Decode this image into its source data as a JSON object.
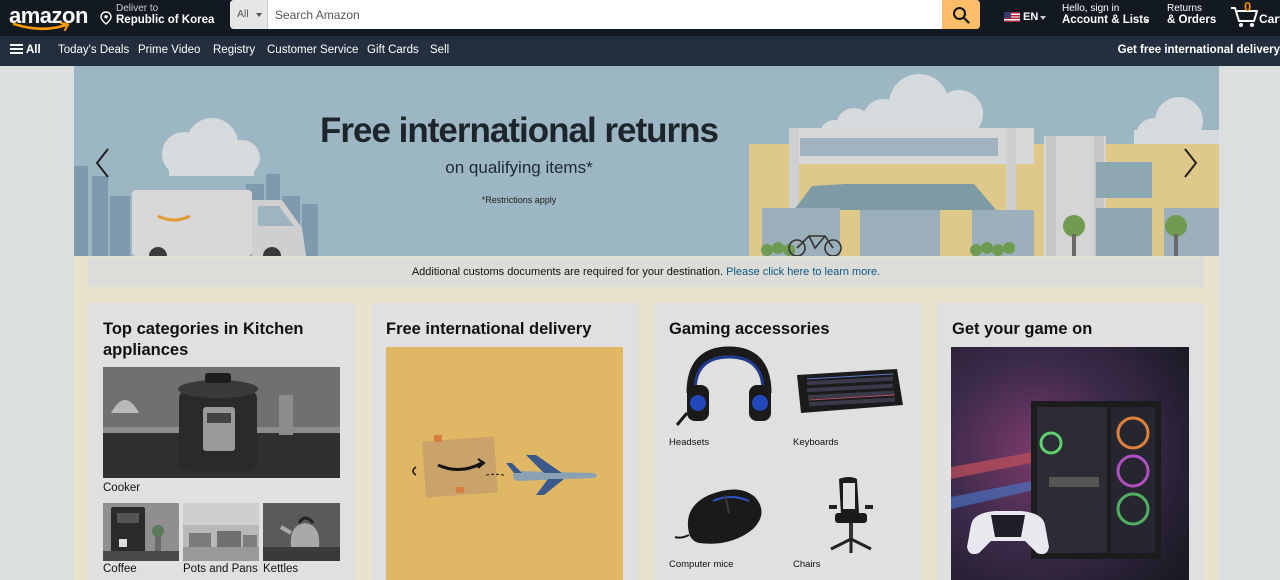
{
  "header": {
    "logo_text": "amazon",
    "deliver_line1": "Deliver to",
    "deliver_line2": "Republic of Korea",
    "search_category": "All",
    "search_placeholder": "Search Amazon",
    "language": "EN",
    "account_line1": "Hello, sign in",
    "account_line2": "Account & Lists",
    "orders_line1": "Returns",
    "orders_line2": "& Orders",
    "cart_count": "0",
    "cart_label": "Cart"
  },
  "subnav": {
    "all_label": "All",
    "items": [
      "Today's Deals",
      "Prime Video",
      "Registry",
      "Customer Service",
      "Gift Cards",
      "Sell"
    ],
    "promo": "Get free international delivery"
  },
  "hero": {
    "title": "Free international returns",
    "subtitle": "on qualifying items*",
    "note": "*Restrictions apply"
  },
  "customs": {
    "text": "Additional customs documents are required for your destination.",
    "link": "Please click here to learn more."
  },
  "cards": [
    {
      "title": "Top categories in Kitchen appliances",
      "items": [
        "Cooker",
        "Coffee",
        "Pots and Pans",
        "Kettles"
      ]
    },
    {
      "title": "Free international delivery"
    },
    {
      "title": "Gaming accessories",
      "items": [
        "Headsets",
        "Keyboards",
        "Computer mice",
        "Chairs"
      ]
    },
    {
      "title": "Get your game on"
    }
  ],
  "colors": {
    "nav_dark": "#131921",
    "nav_secondary": "#232f3e",
    "search_button": "#febd69",
    "cart_count": "#f08804",
    "link": "#0f5a8a"
  }
}
